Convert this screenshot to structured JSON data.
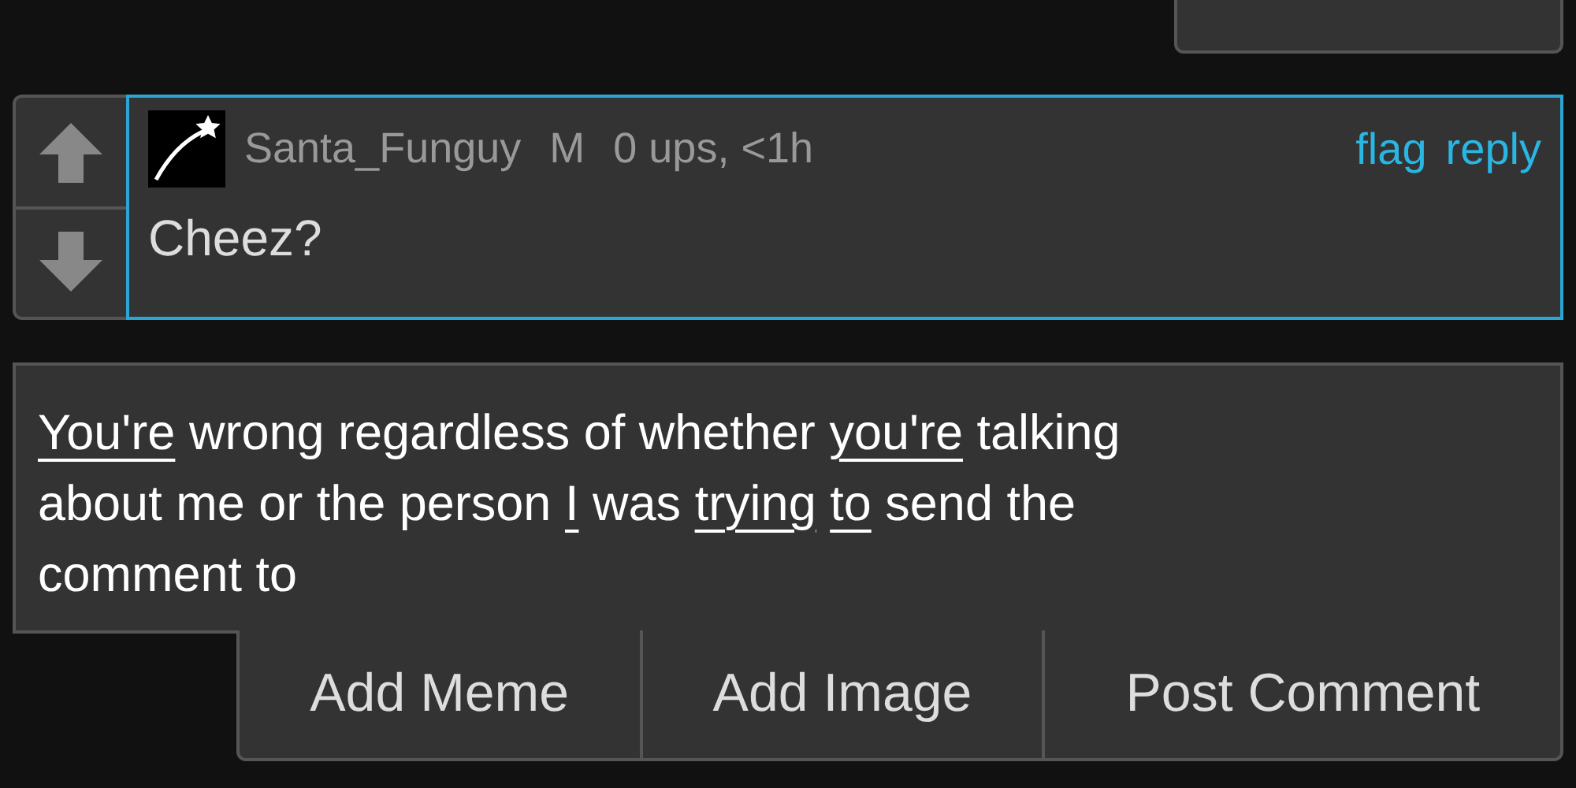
{
  "comment": {
    "username": "Santa_Funguy",
    "gender": "M",
    "meta": "0 ups, <1h",
    "actions": [
      "flag",
      "reply"
    ],
    "text": "Cheez?",
    "highlighted": true
  },
  "reply_field": {
    "lines": [
      [
        {
          "text": "You're",
          "underlined": true
        },
        {
          "text": "wrong regardless of whether",
          "underlined": false
        },
        {
          "text": "you're",
          "underlined": true
        },
        {
          "text": "talking",
          "underlined": false
        }
      ],
      [
        {
          "text": "about me or the person",
          "underlined": false
        },
        {
          "text": "I",
          "underlined": true
        },
        {
          "text": "was",
          "underlined": false
        },
        {
          "text": "trying",
          "underlined": true
        },
        {
          "text": "to",
          "underlined": true
        },
        {
          "text": "send the",
          "underlined": false
        }
      ],
      [
        {
          "text": "comment to",
          "underlined": false
        }
      ]
    ]
  },
  "buttons": [
    "Add Meme",
    "Add Image",
    "Post Comment"
  ]
}
